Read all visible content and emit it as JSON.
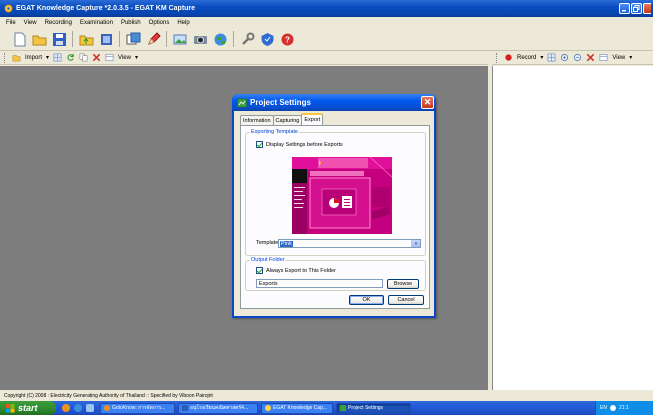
{
  "window": {
    "title": "EGAT Knowledge Capture *2.0.3.5 - EGAT KM Capture"
  },
  "menu": [
    "File",
    "View",
    "Recording",
    "Examination",
    "Publish",
    "Options",
    "Help"
  ],
  "left_toolbar": {
    "import_label": "Import",
    "view_label": "View"
  },
  "right_toolbar": {
    "record_label": "Record",
    "view_label": "View"
  },
  "status_text": "Copyright (C) 2008 : Electricity Generating Authority of Thailand :: Specified by Viboon Pairojnt",
  "dialog": {
    "title": "Project Settings",
    "tabs": [
      "Information",
      "Capturing",
      "Export"
    ],
    "selected_tab": "Export",
    "exporting_template_group": "Exporting Template",
    "display_settings_label": "Display Settings before Exports",
    "display_settings_checked": true,
    "template_label": "Template",
    "template_value": "Pink",
    "output_folder_group": "Output Folder",
    "always_export_label": "Always Export to This Folder",
    "always_export_checked": true,
    "folder_value": "Exports",
    "browse_label": "Browse",
    "ok_label": "OK",
    "cancel_label": "Cancel"
  },
  "taskbar": {
    "start_label": "start",
    "items": [
      {
        "label": "GotoKnow: การจัดการ..."
      },
      {
        "label": "อนุโรงเรียนคณิตศาสตร์4..."
      },
      {
        "label": "EGAT Knowledge Cap..."
      },
      {
        "label": "Project Settings"
      }
    ],
    "language": "EN",
    "clock": "21:1"
  },
  "colors": {
    "titlebar": "#0a4ec0",
    "workspace": "#7d7d7d",
    "preview_bg": "#c0007d",
    "taskbar": "#245edb",
    "start": "#3c9d3c"
  }
}
